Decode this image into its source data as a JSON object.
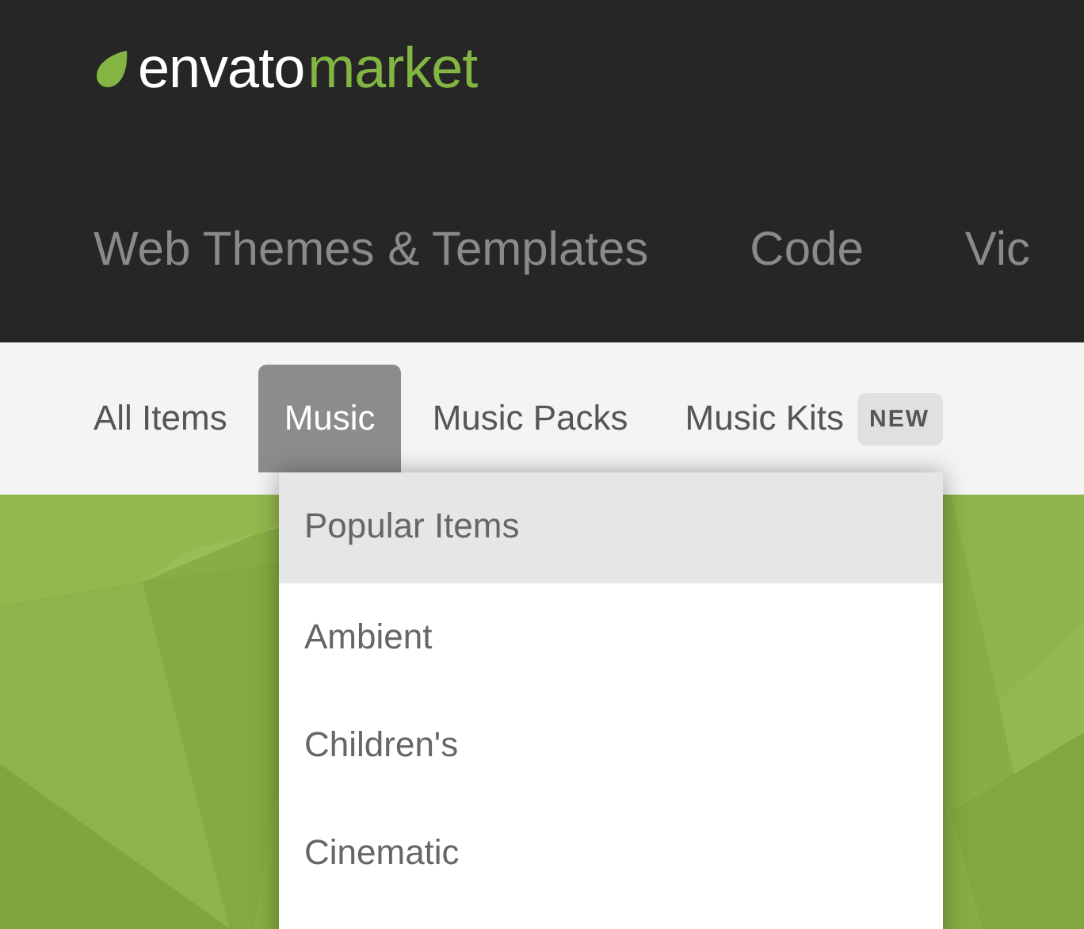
{
  "logo": {
    "brand": "envato",
    "product": "market"
  },
  "categories": [
    {
      "label": "Web Themes & Templates"
    },
    {
      "label": "Code"
    },
    {
      "label": "Vic"
    }
  ],
  "subnav": [
    {
      "label": "All Items",
      "selected": false
    },
    {
      "label": "Music",
      "selected": true
    },
    {
      "label": "Music Packs",
      "selected": false
    },
    {
      "label": "Music Kits",
      "selected": false,
      "badge": "NEW"
    }
  ],
  "dropdown": {
    "items": [
      {
        "label": "Popular Items",
        "selected": true
      },
      {
        "label": "Ambient",
        "selected": false
      },
      {
        "label": "Children's",
        "selected": false
      },
      {
        "label": "Cinematic",
        "selected": false
      }
    ]
  }
}
